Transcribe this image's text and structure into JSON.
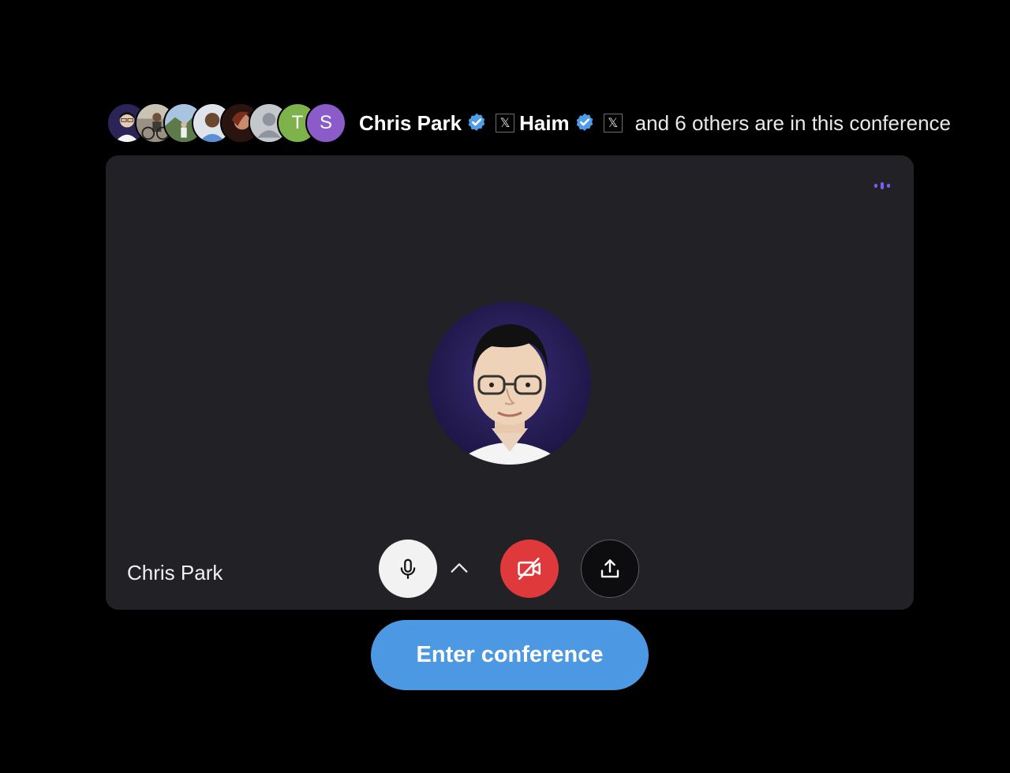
{
  "header": {
    "participant_avatars": [
      {
        "kind": "photo",
        "icon": "person-photo-icon",
        "color": "#2b2457"
      },
      {
        "kind": "photo",
        "icon": "person-photo-icon",
        "color": "#8a8378"
      },
      {
        "kind": "photo",
        "icon": "person-photo-icon",
        "color": "#5d7fa5"
      },
      {
        "kind": "photo",
        "icon": "person-photo-icon",
        "color": "#6a8fc0"
      },
      {
        "kind": "photo",
        "icon": "person-photo-icon",
        "color": "#5a2d22"
      },
      {
        "kind": "placeholder",
        "icon": "default-avatar-icon",
        "color": "#b6bbc1"
      },
      {
        "kind": "initial",
        "initial": "T",
        "color": "#7eb24a"
      },
      {
        "kind": "initial",
        "initial": "S",
        "color": "#8b5cc9"
      }
    ],
    "first_name": "Chris Park",
    "second_name": "Haim",
    "x_badge": "𝕏",
    "others_text": "and 6 others are in this conference",
    "verified_color": "#4f9de8"
  },
  "panel": {
    "participant_name": "Chris Park",
    "avatar_icon": "profile-photo-icon",
    "audio_indicator_icon": "audio-level-icon",
    "audio_indicator_color": "#7b5cf5"
  },
  "controls": {
    "mic_icon": "microphone-icon",
    "chevron_icon": "chevron-up-icon",
    "camera_icon": "camera-off-icon",
    "share_icon": "share-upload-icon",
    "camera_off_color": "#e0393c"
  },
  "enter_button": {
    "label": "Enter conference",
    "color": "#4d98e3"
  }
}
